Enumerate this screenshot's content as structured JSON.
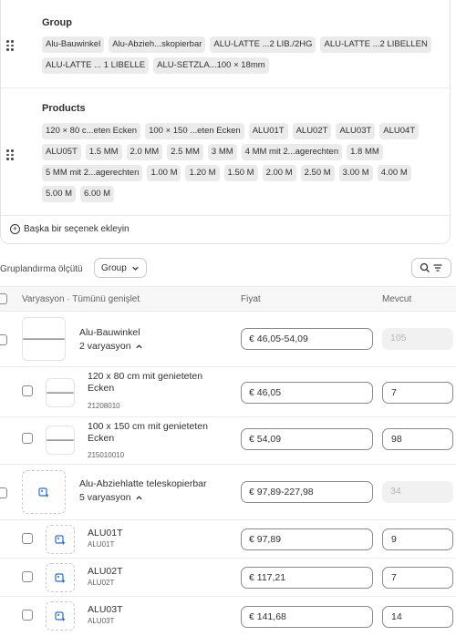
{
  "options": {
    "group": {
      "title": "Group",
      "values": [
        "Alu-Bauwinkel",
        "Alu-Abzieh...skopierbar",
        "ALU-LATTE ...2 LIB./2HG",
        "ALU-LATTE ...2 LIBELLEN",
        "ALU-LATTE ... 1 LIBELLE",
        "ALU-SETZLA...100 × 18mm"
      ]
    },
    "products": {
      "title": "Products",
      "values": [
        "120 × 80 c...eten Ecken",
        "100 × 150 ...eten Ecken",
        "ALU01T",
        "ALU02T",
        "ALU03T",
        "ALU04T",
        "ALU05T",
        "1.5 MM",
        "2.0 MM",
        "2.5 MM",
        "3 MM",
        "4 MM mit 2...agerechten",
        "1.8 MM",
        "5 MM mit 2...agerechten",
        "1.00 M",
        "1.20 M",
        "1.50 M",
        "2.00 M",
        "2.50 M",
        "3.00 M",
        "4.00 M",
        "5.00 M",
        "6.00 M"
      ]
    },
    "add_option_label": "Başka bir seçenek ekleyin"
  },
  "groupby": {
    "label": "Gruplandırma ölçütü",
    "selected": "Group"
  },
  "table": {
    "col_variant": "Varyasyon · Tümünü genişlet",
    "col_price": "Fiyat",
    "col_stock": "Mevcut"
  },
  "rows": {
    "g1": {
      "name": "Alu-Bauwinkel",
      "variants": "2 varyasyon",
      "price": "€ 46,05-54,09",
      "stock": "105"
    },
    "v1": {
      "name": "120 x 80 cm mit genieteten Ecken",
      "sku": "21208010",
      "price": "€ 46,05",
      "stock": "7"
    },
    "v2": {
      "name": "100 x 150 cm mit genieteten Ecken",
      "sku": "215010010",
      "price": "€ 54,09",
      "stock": "98"
    },
    "g2": {
      "name": "Alu-Abziehlatte teleskopierbar",
      "variants": "5 varyasyon",
      "price": "€ 97,89-227,98",
      "stock": "34"
    },
    "v3": {
      "name": "ALU01T",
      "sku": "ALU01T",
      "price": "€ 97,89",
      "stock": "9"
    },
    "v4": {
      "name": "ALU02T",
      "sku": "ALU02T",
      "price": "€ 117,21",
      "stock": "7"
    },
    "v5": {
      "name": "ALU03T",
      "sku": "ALU03T",
      "price": "€ 141,68",
      "stock": "14"
    }
  },
  "icons": {
    "drag": "drag-handle-icon",
    "add": "plus-circle-icon",
    "chevron": "chevron-down-icon",
    "collapse": "chevron-up-icon",
    "search": "search-icon",
    "filter": "filter-icon",
    "image_add": "image-add-icon"
  },
  "colors": {
    "accent": "#2c6ecb",
    "chip_bg": "#ebebeb",
    "border": "#8a8a8a",
    "header_bg": "#f7f7f7"
  }
}
